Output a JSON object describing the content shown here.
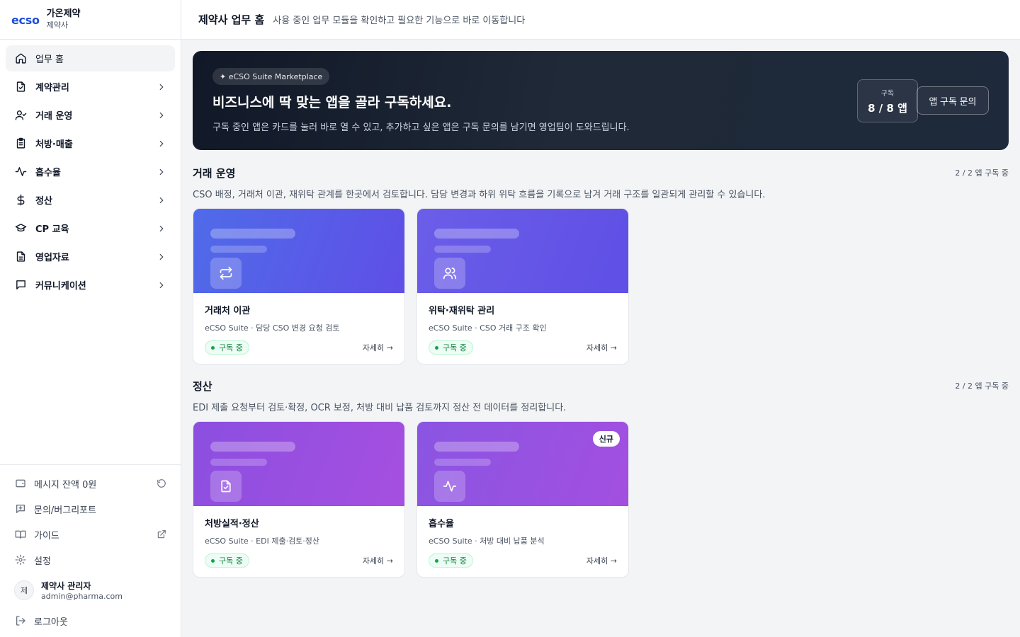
{
  "brand": {
    "logo": "ecso",
    "company": "가온제약",
    "type": "제약사"
  },
  "nav": [
    {
      "label": "업무 홈",
      "icon": "home-icon"
    },
    {
      "label": "계약관리",
      "icon": "file-check-icon"
    },
    {
      "label": "거래 운영",
      "icon": "user-check-icon"
    },
    {
      "label": "처방·매출",
      "icon": "clipboard-icon"
    },
    {
      "label": "흡수율",
      "icon": "activity-icon"
    },
    {
      "label": "정산",
      "icon": "dollar-icon"
    },
    {
      "label": "CP 교육",
      "icon": "graduation-cap-icon"
    },
    {
      "label": "영업자료",
      "icon": "file-text-icon"
    },
    {
      "label": "커뮤니케이션",
      "icon": "message-square-icon"
    }
  ],
  "footer": {
    "message_balance": "메시지 잔액 0원",
    "report": "문의/버그리포트",
    "guide": "가이드",
    "settings": "설정",
    "user": {
      "initial": "제",
      "name": "제약사 관리자",
      "email": "admin@pharma.com"
    },
    "logout": "로그아웃"
  },
  "header": {
    "title": "제약사 업무 홈",
    "subtitle": "사용 중인 업무 모듈을 확인하고 필요한 기능으로 바로 이동합니다"
  },
  "hero": {
    "pill": "✦ eCSO Suite Marketplace",
    "title": "비즈니스에 딱 맞는 앱을 골라 구독하세요.",
    "desc": "구독 중인 앱은 카드를 눌러 바로 열 수 있고, 추가하고 싶은 앱은 구독 문의를 남기면 영업팀이 도와드립니다.",
    "count_label": "구독",
    "count_value": "8 / 8 앱",
    "button": "앱 구독 문의"
  },
  "sections": [
    {
      "title": "거래 운영",
      "count": "2 / 2 앱 구독 중",
      "desc": "CSO 배정, 거래처 이관, 재위탁 관계를 한곳에서 검토합니다. 담당 변경과 하위 위탁 흐름을 기록으로 남겨 거래 구조를 일관되게 관리할 수 있습니다.",
      "cards": [
        {
          "title": "거래처 이관",
          "sub": "eCSO Suite · 담당 CSO 변경 요청 검토",
          "status": "구독 중",
          "detail": "자세히 →",
          "icon": "repeat-icon"
        },
        {
          "title": "위탁·재위탁 관리",
          "sub": "eCSO Suite · CSO 거래 구조 확인",
          "status": "구독 중",
          "detail": "자세히 →",
          "icon": "users-icon"
        }
      ]
    },
    {
      "title": "정산",
      "count": "2 / 2 앱 구독 중",
      "desc": "EDI 제출 요청부터 검토·확정, OCR 보정, 처방 대비 납품 검토까지 정산 전 데이터를 정리합니다.",
      "cards": [
        {
          "title": "처방실적·정산",
          "sub": "eCSO Suite · EDI 제출·검토·정산",
          "status": "구독 중",
          "detail": "자세히 →",
          "icon": "file-check-icon"
        },
        {
          "title": "흡수율",
          "sub": "eCSO Suite · 처방 대비 납품 분석",
          "status": "구독 중",
          "detail": "자세히 →",
          "icon": "activity-icon",
          "badge": "신규"
        }
      ]
    }
  ]
}
